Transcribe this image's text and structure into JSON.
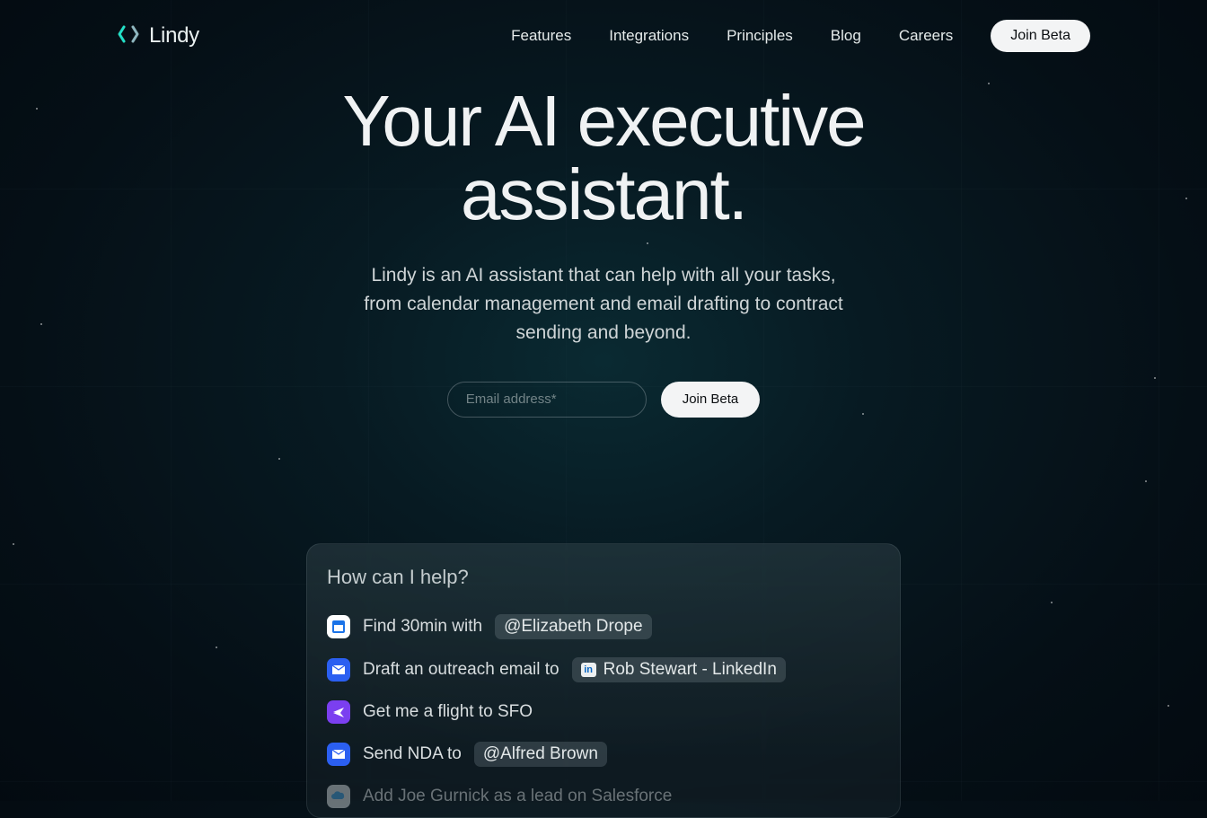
{
  "brand": {
    "name": "Lindy"
  },
  "nav": {
    "items": [
      "Features",
      "Integrations",
      "Principles",
      "Blog",
      "Careers"
    ],
    "cta": "Join Beta"
  },
  "hero": {
    "headline": "Your AI executive assistant.",
    "subhead": "Lindy is an AI assistant that can help with all your tasks, from calendar management and email drafting to contract sending and beyond."
  },
  "signup": {
    "placeholder": "Email address*",
    "button": "Join Beta"
  },
  "card": {
    "title": "How can I help?",
    "suggestions": [
      {
        "icon": "calendar",
        "prefix": "Find 30min with",
        "pill": "@Elizabeth Drope",
        "pill_icon": null,
        "suffix": ""
      },
      {
        "icon": "mail",
        "prefix": "Draft an outreach email to",
        "pill": "Rob Stewart - LinkedIn",
        "pill_icon": "in",
        "suffix": ""
      },
      {
        "icon": "plane",
        "prefix": "Get me a flight to SFO",
        "pill": null,
        "pill_icon": null,
        "suffix": ""
      },
      {
        "icon": "mail",
        "prefix": "Send NDA to",
        "pill": "@Alfred Brown",
        "pill_icon": null,
        "suffix": ""
      },
      {
        "icon": "cloud",
        "prefix": "Add Joe Gurnick as a lead on Salesforce",
        "pill": null,
        "pill_icon": null,
        "suffix": "",
        "faded": true
      }
    ]
  }
}
